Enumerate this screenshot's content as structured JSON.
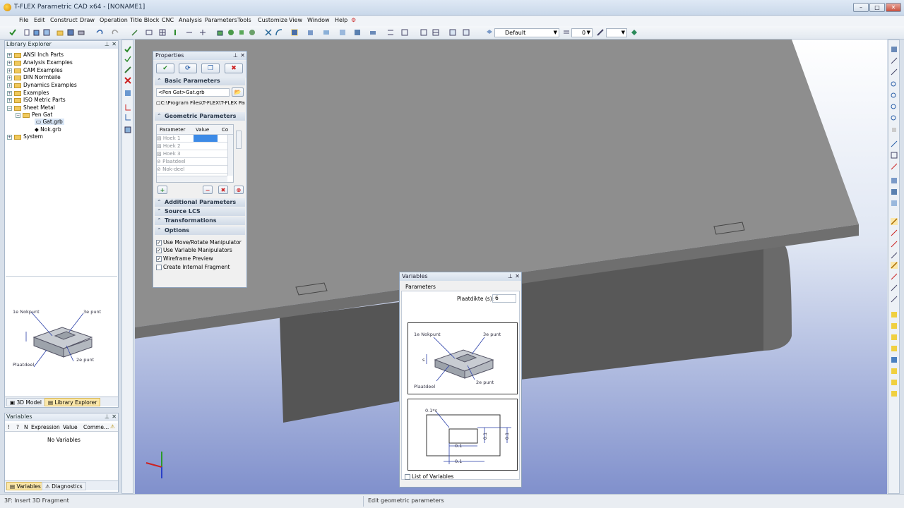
{
  "window": {
    "title": "T-FLEX Parametric CAD x64 - [NONAME1]",
    "min_label": "–",
    "max_label": "□",
    "close_label": "✕"
  },
  "menu": [
    "File",
    "Edit",
    "Construct",
    "Draw",
    "Operation",
    "Title Block",
    "CNC",
    "Analysis",
    "Parameters",
    "Tools",
    "Customize",
    "View",
    "Window",
    "Help"
  ],
  "toolbar": {
    "layer_combo": "Default",
    "level_combo": "0"
  },
  "library_explorer": {
    "title": "Library Explorer",
    "items": [
      "ANSI Inch Parts",
      "Analysis Examples",
      "CAM Examples",
      "DIN Normteile",
      "Dynamics Examples",
      "Examples",
      "ISO Metric Parts",
      "Sheet Metal",
      "Pen Gat",
      "Gat.grb",
      "Nok.grb",
      "System"
    ],
    "preview_labels": {
      "p1": "1e Nokpunt",
      "p3": "3e punt",
      "p2": "2e punt",
      "plate": "Plaatdeel"
    },
    "tabs": [
      "3D Model",
      "Library Explorer"
    ]
  },
  "variables_panel": {
    "title": "Variables",
    "columns": [
      "!",
      "?",
      "N",
      "Expression",
      "Value",
      "Comme..."
    ],
    "empty_text": "No Variables",
    "tabs": [
      "Variables",
      "Diagnostics"
    ]
  },
  "properties": {
    "title": "Properties",
    "sections": {
      "basic": "Basic Parameters",
      "geometric": "Geometric Parameters",
      "additional": "Additional Parameters",
      "source_lcs": "Source LCS",
      "transformations": "Transformations",
      "options": "Options"
    },
    "file_combo": "<Pen Gat>Gat.grb",
    "file_path": "C:\\Program Files\\T-FLEX\\T-FLEX Par",
    "grid_headers": [
      "Parameter",
      "Value",
      "Co"
    ],
    "grid_rows": [
      "Hoek 1",
      "Hoek 2",
      "Hoek 3",
      "Plaatdeel",
      "Nok-deel"
    ],
    "options": [
      {
        "label": "Use Move/Rotate Manipulator",
        "checked": true
      },
      {
        "label": "Use Variable Manipulators",
        "checked": true
      },
      {
        "label": "Wireframe Preview",
        "checked": true
      },
      {
        "label": "Create Internal Fragment",
        "checked": false
      }
    ]
  },
  "variables_dialog": {
    "title": "Variables",
    "group": "Parameters",
    "field_label": "Plaatdikte (s):",
    "field_value": "6",
    "preview_labels": {
      "p1": "1e Nokpunt",
      "p3": "3e punt",
      "p2": "2e punt",
      "plate": "Plaatdeel",
      "s": "s"
    },
    "dims": {
      "d1": "0.1*s",
      "d2": "0.1",
      "d3": "0.1",
      "d4": "0.1",
      "d5": "0.1"
    },
    "list_label": "List of Variables"
  },
  "status": {
    "left": "3F: Insert 3D Fragment",
    "center": "Edit geometric parameters"
  },
  "colors": {
    "viewport_top": "#ffffff",
    "viewport_bottom": "#8090cc",
    "model_top": "#8e8e8e",
    "model_side": "#4f4f4f",
    "highlight": "#fbe7a9"
  }
}
